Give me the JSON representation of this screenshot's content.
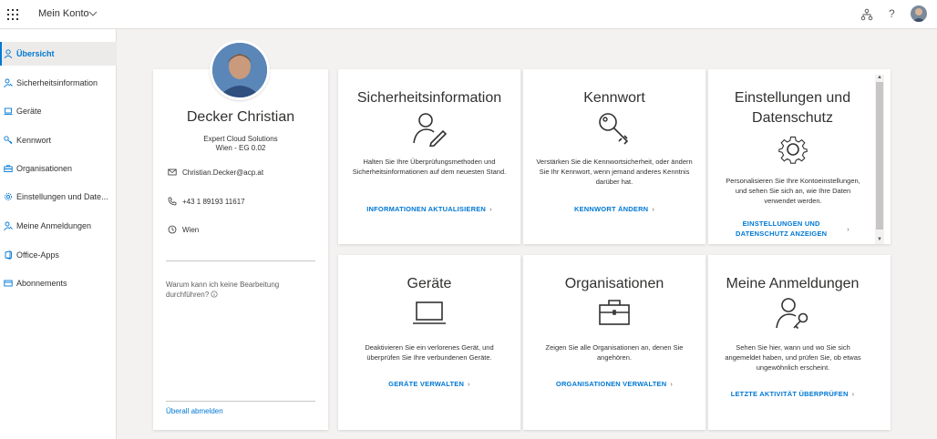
{
  "header": {
    "app_title": "Mein Konto",
    "help_label": "?"
  },
  "sidebar": {
    "items": [
      {
        "label": "Übersicht",
        "icon": "person-icon",
        "active": true
      },
      {
        "label": "Sicherheitsinformation",
        "icon": "person-key-icon"
      },
      {
        "label": "Geräte",
        "icon": "laptop-icon"
      },
      {
        "label": "Kennwort",
        "icon": "key-icon"
      },
      {
        "label": "Organisationen",
        "icon": "briefcase-icon"
      },
      {
        "label": "Einstellungen und Date...",
        "icon": "gear-icon"
      },
      {
        "label": "Meine Anmeldungen",
        "icon": "person-key-icon"
      },
      {
        "label": "Office-Apps",
        "icon": "office-icon"
      },
      {
        "label": "Abonnements",
        "icon": "card-icon"
      }
    ]
  },
  "profile": {
    "name": "Decker Christian",
    "org_line1": "Expert Cloud Solutions",
    "org_line2": "Wien - EG 0.02",
    "email": "Christian.Decker@acp.at",
    "phone": "+43 1 89193 11617",
    "location": "Wien",
    "why_text": "Warum kann ich keine Bearbeitung durchführen?",
    "signout_label": "Überall abmelden"
  },
  "tiles": {
    "security": {
      "title": "Sicherheitsinformation",
      "desc": "Halten Sie Ihre Überprüfungsmethoden und Sicherheitsinformationen auf dem neuesten Stand.",
      "link": "INFORMATIONEN AKTUALISIEREN"
    },
    "password": {
      "title": "Kennwort",
      "desc": "Verstärken Sie die Kennwortsicherheit, oder ändern Sie Ihr Kennwort, wenn jemand anderes Kenntnis darüber hat.",
      "link": "KENNWORT ÄNDERN"
    },
    "settings": {
      "title_line1": "Einstellungen und",
      "title_line2": "Datenschutz",
      "desc": "Personalisieren Sie Ihre Kontoeinstellungen, und sehen Sie sich an, wie Ihre Daten verwendet werden.",
      "link_line1": "EINSTELLUNGEN UND",
      "link_line2": "DATENSCHUTZ ANZEIGEN"
    },
    "devices": {
      "title": "Geräte",
      "desc": "Deaktivieren Sie ein verlorenes Gerät, und überprüfen Sie Ihre verbundenen Geräte.",
      "link": "GERÄTE VERWALTEN"
    },
    "organizations": {
      "title": "Organisationen",
      "desc": "Zeigen Sie alle Organisationen an, denen Sie angehören.",
      "link": "ORGANISATIONEN VERWALTEN"
    },
    "signins": {
      "title": "Meine Anmeldungen",
      "desc": "Sehen Sie hier, wann und wo Sie sich angemeldet haben, und prüfen Sie, ob etwas ungewöhnlich erscheint.",
      "link": "LETZTE AKTIVITÄT ÜBERPRÜFEN"
    },
    "chevron": "›"
  },
  "colors": {
    "accent": "#0078d4",
    "background": "#f3f2f1"
  }
}
